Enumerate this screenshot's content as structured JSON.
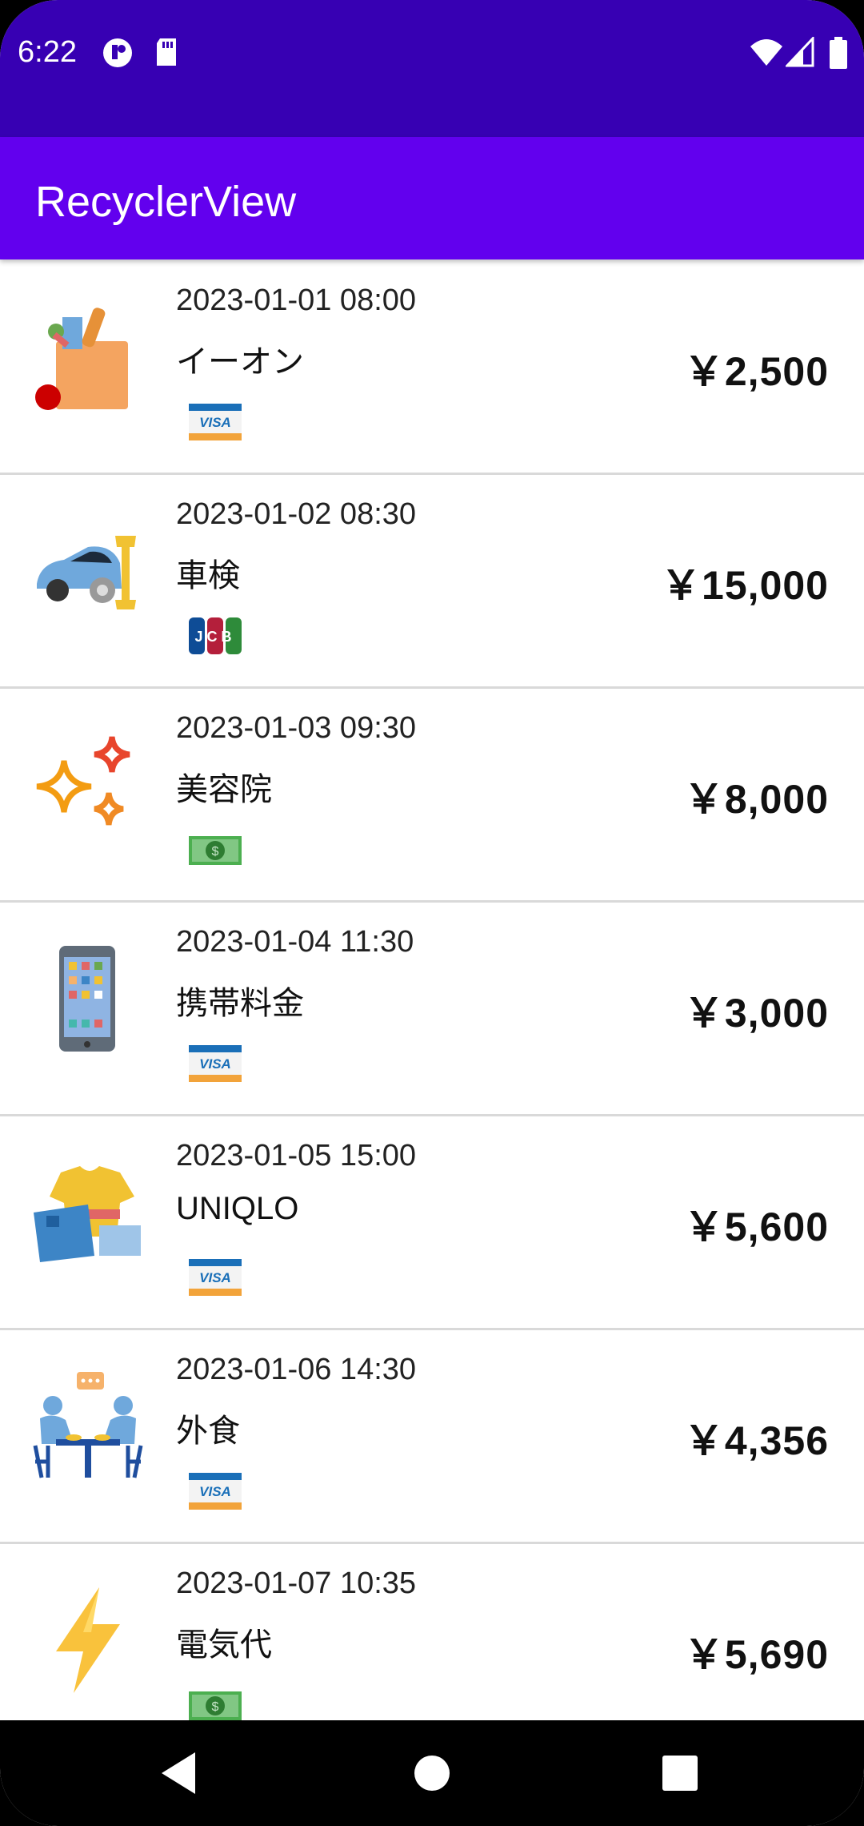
{
  "status_bar": {
    "time": "6:22"
  },
  "app_bar": {
    "title": "RecyclerView"
  },
  "items": [
    {
      "date": "2023-01-01 08:00",
      "name": "イーオン",
      "amount": "￥2,500",
      "category_icon": "grocery-bag-icon",
      "payment_icon": "visa-card-icon",
      "payment_label": "VISA"
    },
    {
      "date": "2023-01-02 08:30",
      "name": "車検",
      "amount": "￥15,000",
      "category_icon": "car-repair-icon",
      "payment_icon": "jcb-card-icon",
      "payment_label": "JCB"
    },
    {
      "date": "2023-01-03 09:30",
      "name": "美容院",
      "amount": "￥8,000",
      "category_icon": "sparkle-icon",
      "payment_icon": "cash-icon",
      "payment_label": "$"
    },
    {
      "date": "2023-01-04 11:30",
      "name": "携帯料金",
      "amount": "￥3,000",
      "category_icon": "smartphone-icon",
      "payment_icon": "visa-card-icon",
      "payment_label": "VISA"
    },
    {
      "date": "2023-01-05 15:00",
      "name": "UNIQLO",
      "amount": "￥5,600",
      "category_icon": "clothes-icon",
      "payment_icon": "visa-card-icon",
      "payment_label": "VISA"
    },
    {
      "date": "2023-01-06 14:30",
      "name": "外食",
      "amount": "￥4,356",
      "category_icon": "dining-icon",
      "payment_icon": "visa-card-icon",
      "payment_label": "VISA"
    },
    {
      "date": "2023-01-07 10:35",
      "name": "電気代",
      "amount": "￥5,690",
      "category_icon": "lightning-icon",
      "payment_icon": "cash-icon",
      "payment_label": "$"
    }
  ],
  "colors": {
    "status_bar": "#3700B3",
    "app_bar": "#6200EE"
  }
}
